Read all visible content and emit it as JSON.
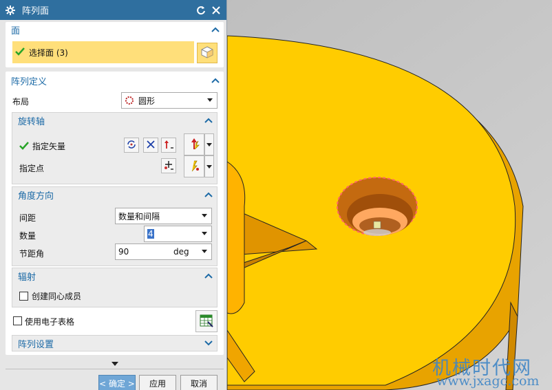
{
  "dialog": {
    "title": "阵列面",
    "face_section": {
      "header": "面",
      "select_label": "选择面 (3)"
    },
    "array_def": {
      "header": "阵列定义",
      "layout_label": "布局",
      "layout_value": "圆形",
      "rotation_axis": {
        "header": "旋转轴",
        "vector_label": "指定矢量",
        "point_label": "指定点"
      },
      "angular_direction": {
        "header": "角度方向",
        "spacing_label": "间距",
        "spacing_value": "数量和间隔",
        "count_label": "数量",
        "count_value": "4",
        "pitch_label": "节距角",
        "pitch_value": "90",
        "pitch_unit": "deg"
      },
      "radiate": {
        "header": "辐射",
        "concentric_label": "创建同心成员"
      },
      "spreadsheet_label": "使用电子表格",
      "settings_header": "阵列设置"
    },
    "buttons": {
      "ok": "< 确定 >",
      "apply": "应用",
      "cancel": "取消"
    }
  },
  "watermark": {
    "line1": "机械时代网",
    "line2": "www.jxagc.com"
  },
  "colors": {
    "part_fill": "#ffcc00",
    "titlebar": "#2f6f9f",
    "accent": "#1c6aa6",
    "selected_row": "#ffdf7a",
    "check_green": "#28a428"
  }
}
